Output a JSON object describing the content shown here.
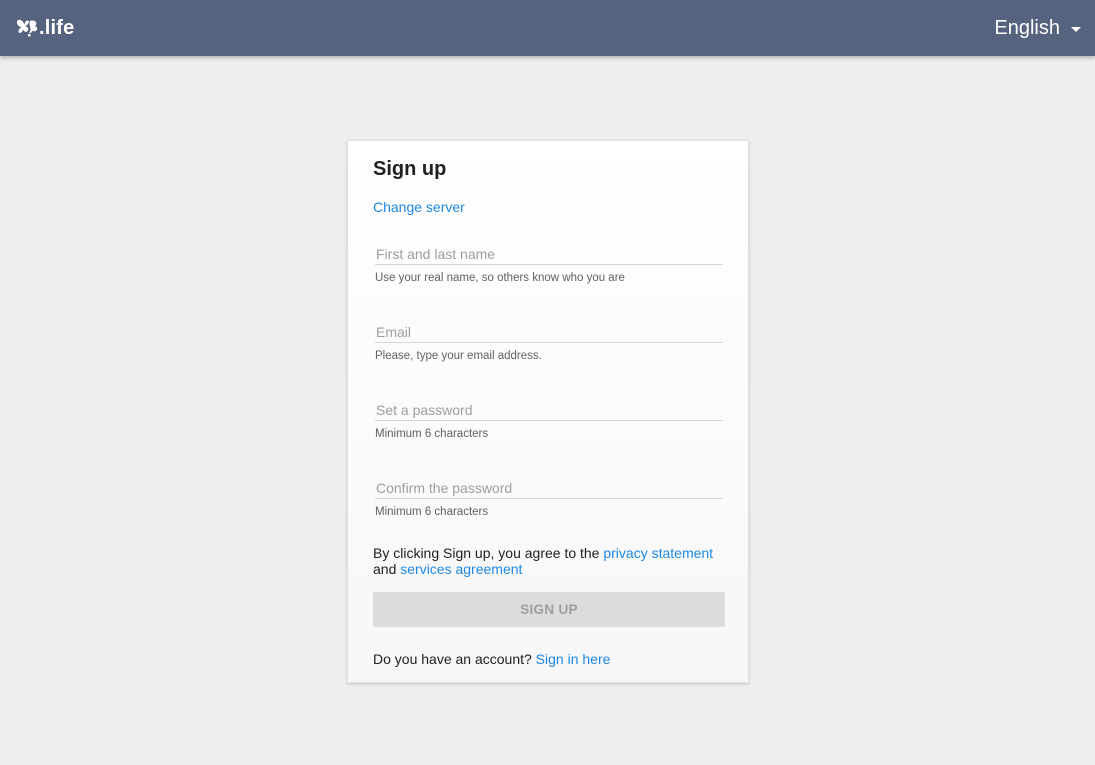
{
  "header": {
    "logo_text": ".life",
    "language": "English"
  },
  "signup": {
    "title": "Sign up",
    "change_server": "Change server",
    "fields": [
      {
        "placeholder": "First and last name",
        "value": "",
        "hint": "Use your real name, so others know who you are"
      },
      {
        "placeholder": "Email",
        "value": "",
        "hint": "Please, type your email address."
      },
      {
        "placeholder": "Set a password",
        "value": "",
        "hint": "Minimum 6 characters"
      },
      {
        "placeholder": "Confirm the password",
        "value": "",
        "hint": "Minimum 6 characters"
      }
    ],
    "agree_prefix": "By clicking Sign up, you agree to the ",
    "privacy_link": "privacy statement",
    "agree_and": "and ",
    "services_link": "services agreement",
    "button_label": "SIGN UP",
    "account_question": "Do you have an account? ",
    "signin_link": "Sign in here"
  },
  "colors": {
    "header_bg": "#56637e",
    "link": "#1e88e5",
    "button_disabled_bg": "#dcdcdc",
    "page_bg": "#eeeeee"
  }
}
